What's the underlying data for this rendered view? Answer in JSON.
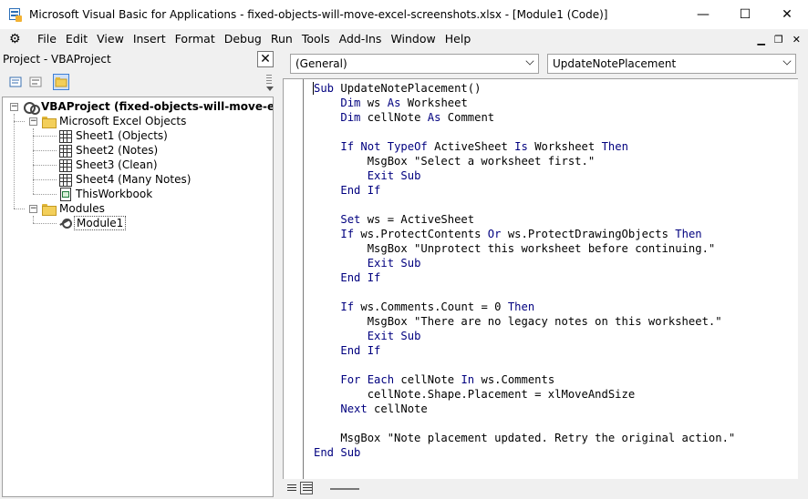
{
  "window": {
    "title": "Microsoft Visual Basic for Applications - fixed-objects-will-move-excel-screenshots.xlsx - [Module1 (Code)]",
    "minimize": "—",
    "maximize": "☐",
    "close": "✕"
  },
  "menu": [
    "File",
    "Edit",
    "View",
    "Insert",
    "Format",
    "Debug",
    "Run",
    "Tools",
    "Add-Ins",
    "Window",
    "Help"
  ],
  "mdi": {
    "minimize": "▁",
    "restore": "❐",
    "close": "✕"
  },
  "project": {
    "title": "Project - VBAProject",
    "close": "✕",
    "tree": {
      "root": "VBAProject (fixed-objects-will-move-excel-screenshots.xlsx)",
      "excel_objects_label": "Microsoft Excel Objects",
      "sheets": [
        "Sheet1 (Objects)",
        "Sheet2 (Notes)",
        "Sheet3 (Clean)",
        "Sheet4 (Many Notes)"
      ],
      "workbook": "ThisWorkbook",
      "modules_label": "Modules",
      "modules": [
        "Module1"
      ]
    }
  },
  "code_window": {
    "object_combo": "(General)",
    "procedure_combo": "UpdateNotePlacement"
  },
  "icons": {
    "app": "vba-app-icon",
    "view_code": "view-code-icon",
    "view_object": "view-object-icon",
    "toggle_folders": "toggle-folders-icon"
  }
}
